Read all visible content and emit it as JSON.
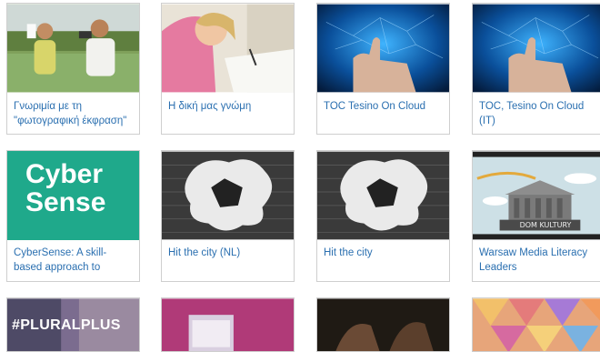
{
  "cards": [
    {
      "label": "Γνωριμία με τη \"φωτογραφική έκφραση\""
    },
    {
      "label": "Η δική μας γνώμη"
    },
    {
      "label": "TOC Tesino On Cloud"
    },
    {
      "label": "TOC, Tesino On Cloud (IT)"
    },
    {
      "label": "CyberSense: A skill-based approach to",
      "thumb_text": "Cyber Sense"
    },
    {
      "label": "Hit the city (NL)"
    },
    {
      "label": "Hit the city"
    },
    {
      "label": "Warsaw Media Literacy Leaders",
      "thumb_sign": "DOM KULTURY"
    },
    {
      "thumb_text": "#PLURALPLUS"
    },
    {},
    {},
    {}
  ],
  "colors": {
    "link": "#2a6fb0",
    "cyber_bg": "#1fa98b",
    "border": "#cfcfcf"
  },
  "icons": [
    "greek-photography-thumb",
    "girl-drawing-thumb",
    "digital-hand-thumb",
    "graffiti-thumb",
    "building-illustration-thumb"
  ]
}
